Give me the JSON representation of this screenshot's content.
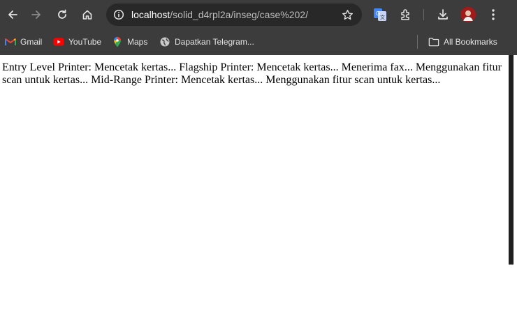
{
  "browser": {
    "url_host": "localhost",
    "url_path": "/solid_d4rpl2a/inseg/case%202/",
    "colors": {
      "toolbar_bg": "#3c3c3c",
      "omnibox_bg": "#282828",
      "avatar": "#a11b1b"
    },
    "toolbar_icons": [
      "back-icon",
      "forward-icon",
      "reload-icon",
      "home-icon",
      "site-info-icon",
      "bookmark-star-icon",
      "google-translate-icon",
      "extensions-icon",
      "downloads-icon",
      "profile-avatar",
      "more-menu-icon"
    ]
  },
  "bookmarks": {
    "items": [
      {
        "label": "Gmail",
        "icon": "gmail-icon"
      },
      {
        "label": "YouTube",
        "icon": "youtube-icon"
      },
      {
        "label": "Maps",
        "icon": "maps-icon"
      },
      {
        "label": "Dapatkan Telegram...",
        "icon": "globe-icon"
      }
    ],
    "all_bookmarks": {
      "label": "All Bookmarks",
      "icon": "folder-icon"
    }
  },
  "page": {
    "text": "Entry Level Printer: Mencetak kertas... Flagship Printer: Mencetak kertas... Menerima fax... Menggunakan fitur scan untuk kertas... Mid-Range Printer: Mencetak kertas... Menggunakan fitur scan untuk kertas..."
  }
}
